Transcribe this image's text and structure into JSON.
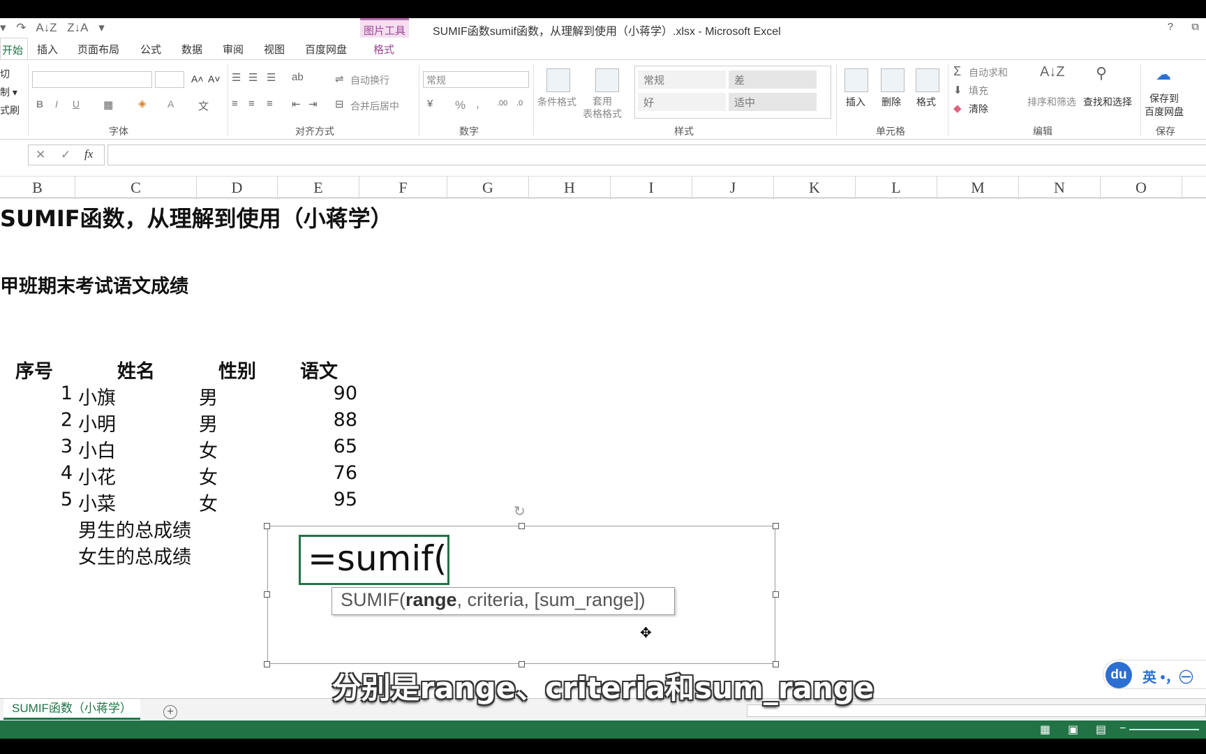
{
  "window": {
    "title": "SUMIF函数sumif函数，从理解到使用（小蒋学）.xlsx - Microsoft Excel",
    "picture_tools": "图片工具",
    "help": "?",
    "restore": "⧉"
  },
  "qat": {
    "undo": "↶",
    "redo": "↷",
    "sort_asc": "A↓Z",
    "sort_desc": "Z↓A",
    "more": "▾"
  },
  "tabs": [
    "开始",
    "插入",
    "页面布局",
    "公式",
    "数据",
    "审阅",
    "视图",
    "百度网盘",
    "格式"
  ],
  "ribbon": {
    "clipboard": {
      "cut": "切",
      "copy": "制 ▾",
      "format_painter": "式刷"
    },
    "font": {
      "label": "字体",
      "bold": "B",
      "italic": "I",
      "underline": "U",
      "grow": "A˄",
      "shrink": "A˅",
      "font_color": "A"
    },
    "alignment": {
      "label": "对齐方式",
      "wrap": "自动换行",
      "merge": "合并后居中"
    },
    "number": {
      "label": "数字",
      "format": "常规",
      "percent": "%",
      "comma": ","
    },
    "styles": {
      "label": "样式",
      "conditional": "条件格式",
      "table": "套用\n表格格式",
      "normal": "常规",
      "bad": "差",
      "good": "好",
      "neutral": "适中"
    },
    "cells": {
      "label": "单元格",
      "insert": "插入",
      "delete": "删除",
      "format": "格式"
    },
    "editing": {
      "label": "编辑",
      "autosum": "自动求和",
      "fill": "填充",
      "clear": "清除",
      "sort": "排序和筛选",
      "find": "查找和选择"
    },
    "save": {
      "label": "保存",
      "baidu": "保存到\n百度网盘"
    }
  },
  "formula_bar": {
    "cancel": "✕",
    "enter": "✓",
    "fx": "fx",
    "value": ""
  },
  "columns": [
    "B",
    "C",
    "D",
    "E",
    "F",
    "G",
    "H",
    "I",
    "J",
    "K",
    "L",
    "M",
    "N",
    "O"
  ],
  "sheet": {
    "title": "SUMIF函数，从理解到使用（小蒋学）",
    "subtitle": "甲班期末考试语文成绩",
    "headers": [
      "序号",
      "姓名",
      "性别",
      "语文"
    ],
    "rows": [
      {
        "no": "1",
        "name": "小旗",
        "gender": "男",
        "score": "90"
      },
      {
        "no": "2",
        "name": "小明",
        "gender": "男",
        "score": "88"
      },
      {
        "no": "3",
        "name": "小白",
        "gender": "女",
        "score": "65"
      },
      {
        "no": "4",
        "name": "小花",
        "gender": "女",
        "score": "76"
      },
      {
        "no": "5",
        "name": "小菜",
        "gender": "女",
        "score": "95"
      }
    ],
    "summary": [
      "男生的总成绩",
      "女生的总成绩"
    ]
  },
  "textbox": {
    "formula": "=sumif(",
    "tooltip_fn": "SUMIF(",
    "tooltip_arg1": "range",
    "tooltip_rest": ", criteria, [sum_range])"
  },
  "sheet_tabs": {
    "active": "SUMIF函数（小蒋学）",
    "add": "+"
  },
  "subtitle": "分别是range、criteria和sum_range",
  "ime": {
    "logo": "du",
    "lang": "英 •，㊀"
  },
  "colors": {
    "excel_green": "#217346",
    "picture_tools": "#a04596"
  }
}
